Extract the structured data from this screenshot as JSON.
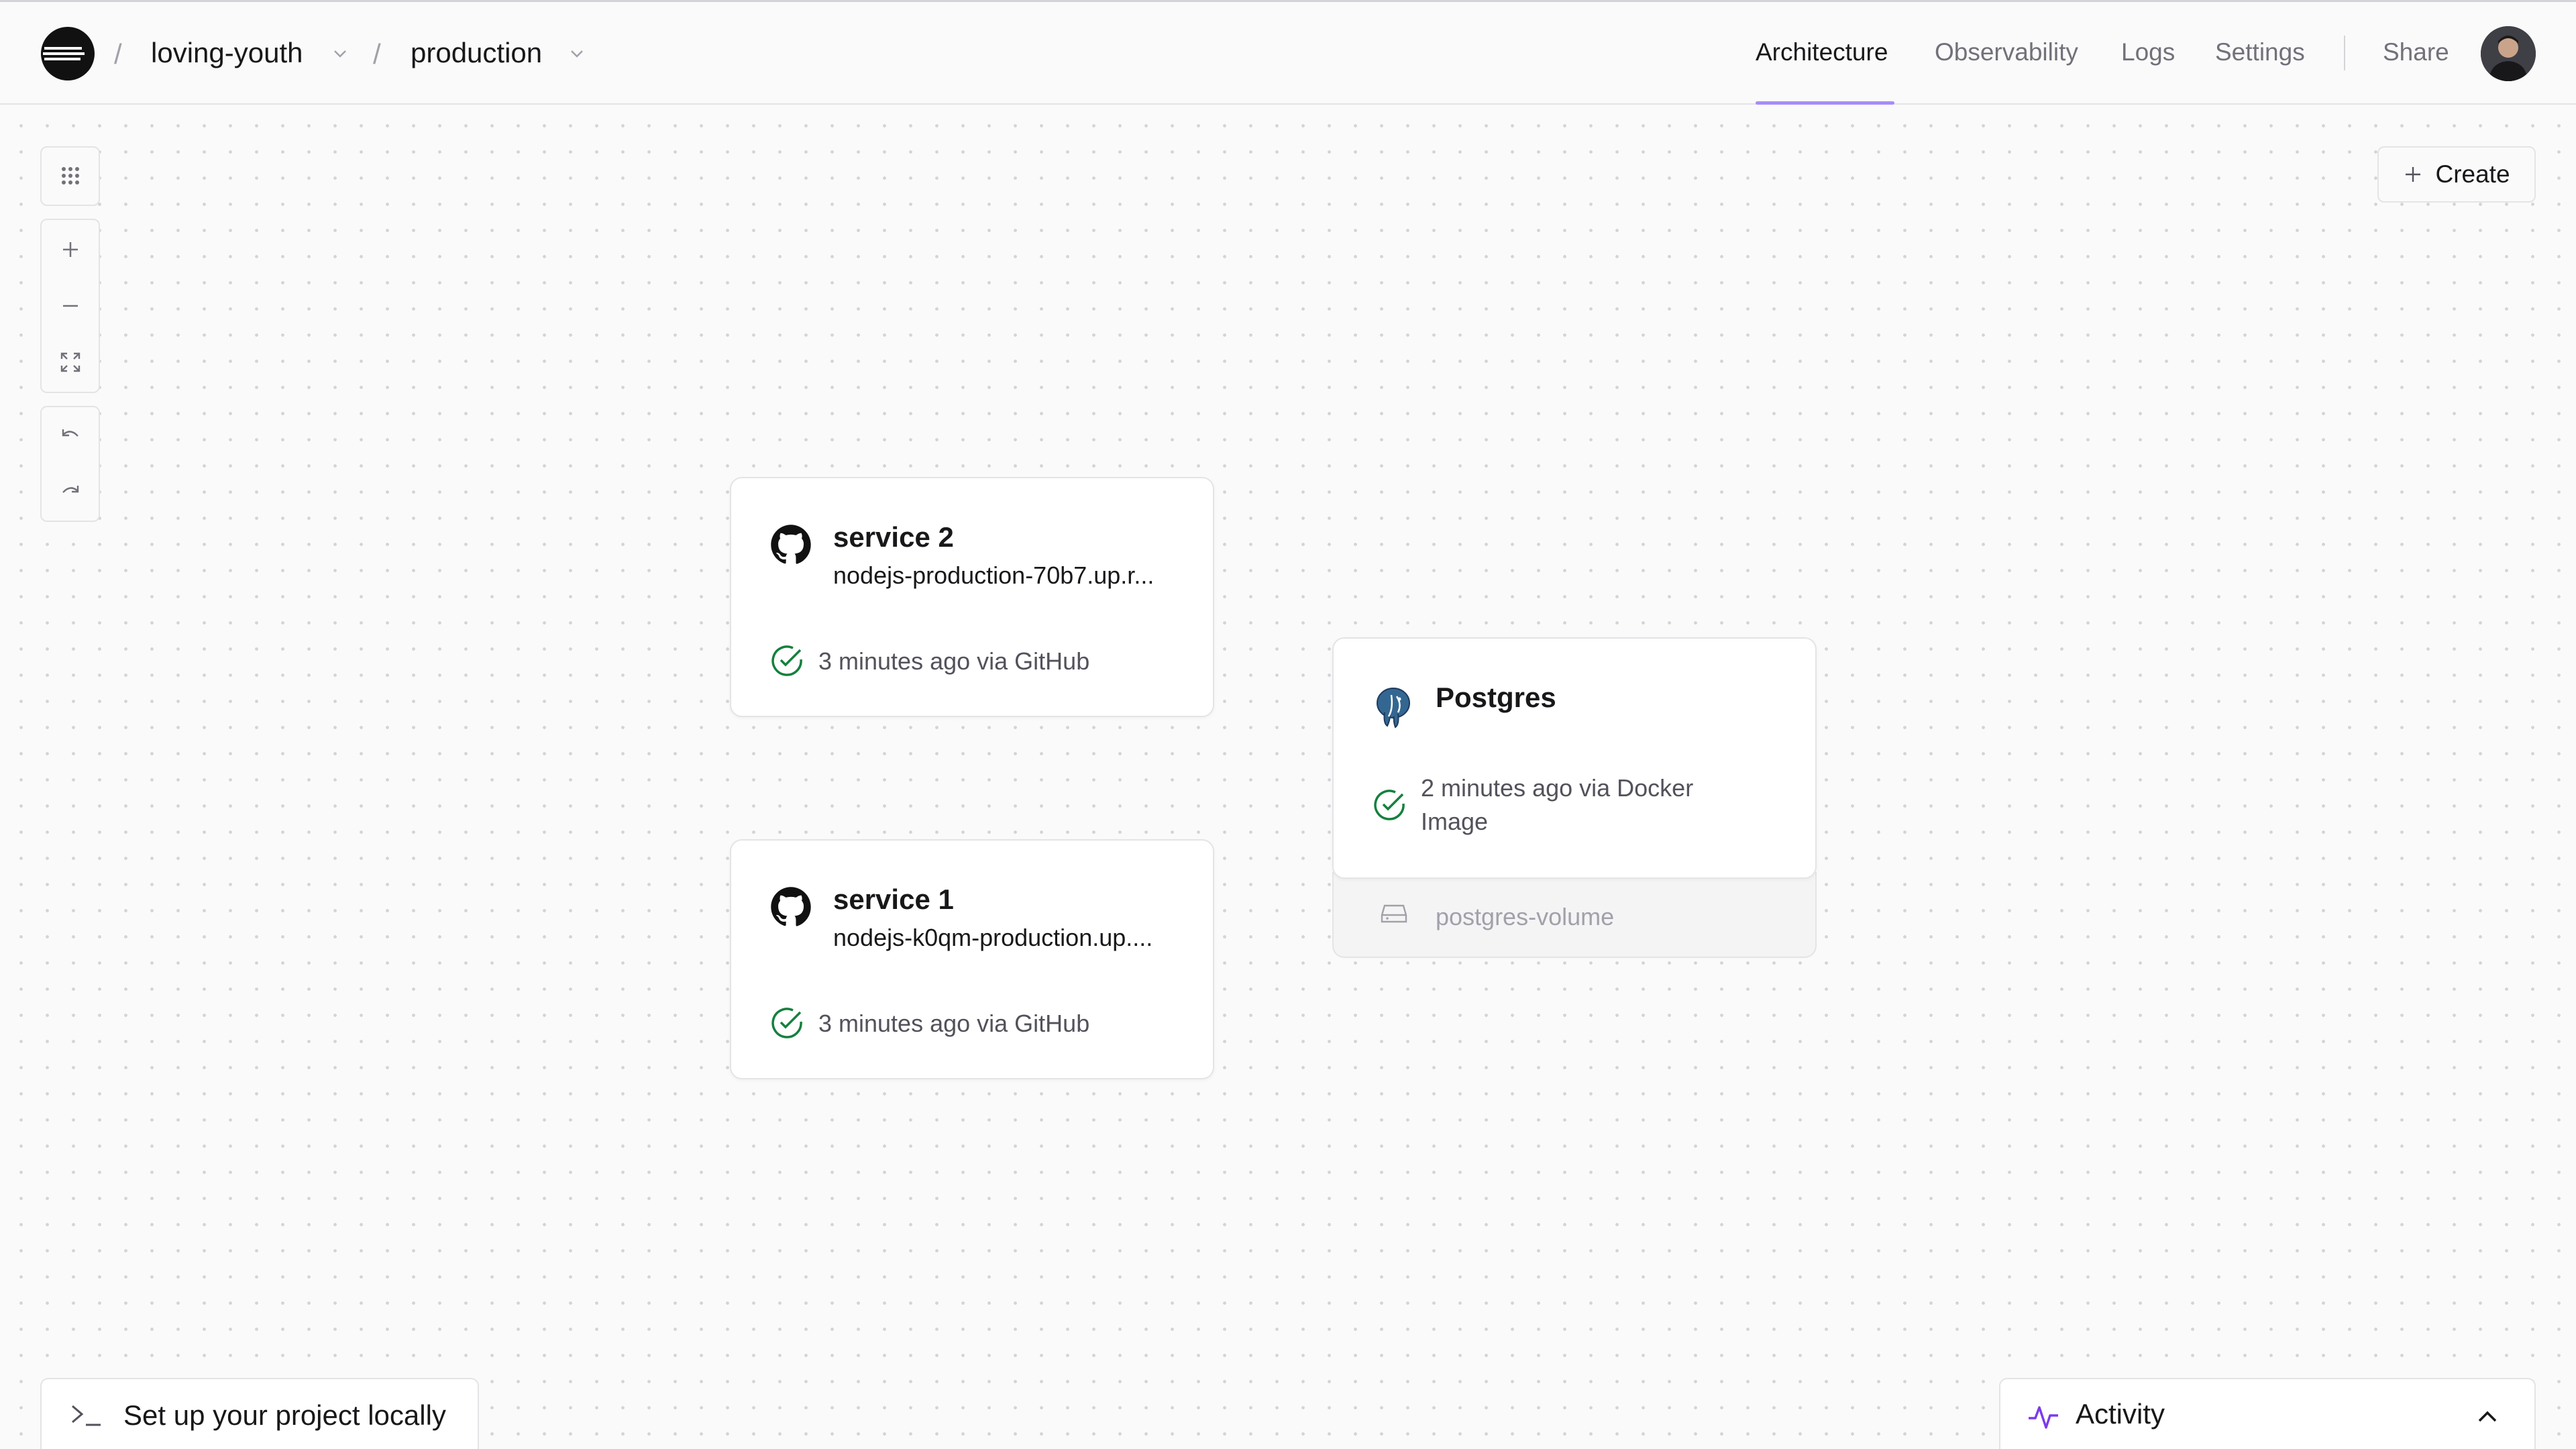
{
  "header": {
    "project": "loving-youth",
    "environment": "production",
    "separator": "/",
    "nav": [
      "Architecture",
      "Observability",
      "Logs",
      "Settings"
    ],
    "share": "Share"
  },
  "toolbar": {
    "create_label": "Create"
  },
  "services": [
    {
      "name": "service 2",
      "domain": "nodejs-production-70b7.up.r...",
      "status": "3 minutes ago via GitHub"
    },
    {
      "name": "service 1",
      "domain": "nodejs-k0qm-production.up....",
      "status": "3 minutes ago via GitHub"
    }
  ],
  "database": {
    "name": "Postgres",
    "status": "2 minutes ago via Docker Image",
    "volume": "postgres-volume"
  },
  "bottom": {
    "setup_label": "Set up your project locally",
    "activity_label": "Activity"
  },
  "colors": {
    "accent": "#a78bfa",
    "success": "#15803d",
    "activity_icon": "#7c3aed"
  }
}
